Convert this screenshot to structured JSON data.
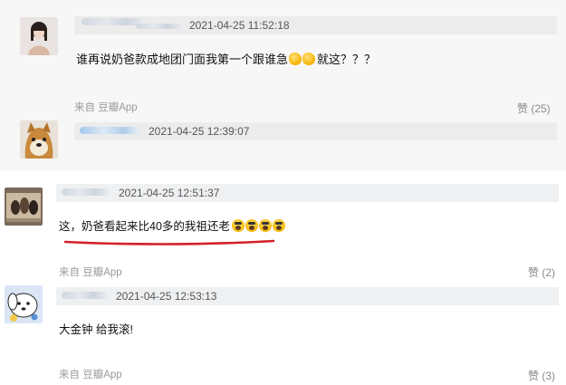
{
  "comments": [
    {
      "avatar_icon": "user-avatar-girl",
      "timestamp": "2021-04-25 11:52:18",
      "text_before": "谁再说奶爸款成地团门面我第一个跟谁急",
      "emojis": [
        "fist-emoji",
        "fist-emoji"
      ],
      "text_after": "就这？？？",
      "source": "来自 豆瓣App",
      "likes": "赞 (25)"
    },
    {
      "avatar_icon": "user-avatar-dog",
      "timestamp": "2021-04-25 12:39:07"
    },
    {
      "avatar_icon": "user-avatar-photo",
      "timestamp": "2021-04-25 12:51:37",
      "text_before": "这，奶爸看起来比40多的我祖还老",
      "emojis": [
        "scream-emoji",
        "scream-emoji",
        "scream-emoji",
        "scream-emoji"
      ],
      "source": "来自 豆瓣App",
      "likes": "赞 (2)"
    },
    {
      "avatar_icon": "user-avatar-pochacco",
      "timestamp": "2021-04-25 12:53:13",
      "text_before": "大金钟 给我滚!",
      "source": "来自 豆瓣App",
      "likes": "赞 (3)"
    }
  ],
  "colors": {
    "underline": "#d3202a",
    "panel": "#f7f7f8",
    "meta": "#9a9a9a"
  }
}
